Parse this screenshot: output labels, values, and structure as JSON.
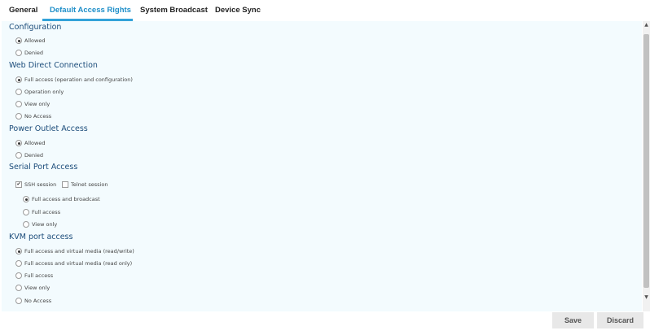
{
  "tabs": [
    {
      "label": "General"
    },
    {
      "label": "Default Access Rights"
    },
    {
      "label": "System Broadcast"
    },
    {
      "label": "Device Sync"
    }
  ],
  "sections": {
    "configuration": {
      "title": "Configuration",
      "options": [
        {
          "label": "Allowed",
          "checked": true
        },
        {
          "label": "Denied",
          "checked": false
        }
      ]
    },
    "web_direct": {
      "title": "Web Direct Connection",
      "options": [
        {
          "label": "Full access (operation and configuration)",
          "checked": true
        },
        {
          "label": "Operation only",
          "checked": false
        },
        {
          "label": "View only",
          "checked": false
        },
        {
          "label": "No Access",
          "checked": false
        }
      ]
    },
    "power_outlet": {
      "title": "Power Outlet Access",
      "options": [
        {
          "label": "Allowed",
          "checked": true
        },
        {
          "label": "Denied",
          "checked": false
        }
      ]
    },
    "serial_port": {
      "title": "Serial Port Access",
      "ssh_label": "SSH session",
      "ssh_checked": true,
      "telnet_label": "Telnet session",
      "telnet_checked": false,
      "options": [
        {
          "label": "Full access and broadcast",
          "checked": true
        },
        {
          "label": "Full access",
          "checked": false
        },
        {
          "label": "View only",
          "checked": false
        }
      ]
    },
    "kvm_port": {
      "title": "KVM port access",
      "options": [
        {
          "label": "Full access and virtual media (read/write)",
          "checked": true
        },
        {
          "label": "Full access and virtual media (read only)",
          "checked": false
        },
        {
          "label": "Full access",
          "checked": false
        },
        {
          "label": "View only",
          "checked": false
        },
        {
          "label": "No Access",
          "checked": false
        }
      ]
    }
  },
  "buttons": {
    "save": "Save",
    "discard": "Discard"
  },
  "colors": {
    "accent": "#1f8fc9",
    "section_title": "#1b4c7a",
    "panel_bg": "#f3fbfe"
  }
}
